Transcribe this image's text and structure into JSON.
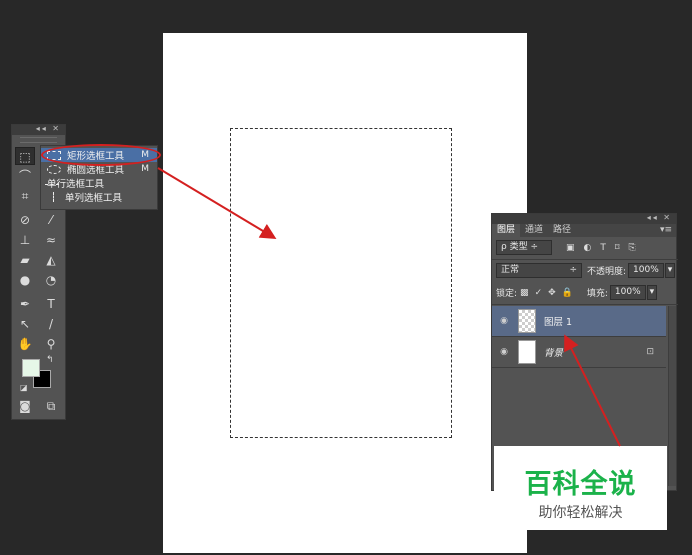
{
  "toolbar": {
    "collapse_label": "◂◂ ✕",
    "tools": [
      {
        "name": "marquee",
        "glyph": "⬚"
      },
      {
        "name": "lasso",
        "glyph": "⌒"
      },
      {
        "name": "crop",
        "glyph": "⌗"
      },
      {
        "name": "eyedropper",
        "glyph": "⊘"
      },
      {
        "name": "spot-healing",
        "glyph": "✎"
      },
      {
        "name": "brush",
        "glyph": "⁄"
      },
      {
        "name": "clone-stamp",
        "glyph": "⊥"
      },
      {
        "name": "history-brush",
        "glyph": "≈"
      },
      {
        "name": "eraser",
        "glyph": "▰"
      },
      {
        "name": "paint-bucket",
        "glyph": "◭"
      },
      {
        "name": "blur",
        "glyph": "●"
      },
      {
        "name": "dodge",
        "glyph": "◔"
      },
      {
        "name": "pen",
        "glyph": "✒"
      },
      {
        "name": "type",
        "glyph": "T"
      },
      {
        "name": "path-selection",
        "glyph": "↖"
      },
      {
        "name": "line",
        "glyph": "/"
      },
      {
        "name": "hand",
        "glyph": "✋"
      },
      {
        "name": "zoom",
        "glyph": "⚲"
      }
    ],
    "foreground_color": "#e6f7e8",
    "background_color": "#000000",
    "quick_mask_glyph": "◙",
    "screen_mode_glyph": "⧉"
  },
  "flyout": {
    "items": [
      {
        "label": "矩形选框工具",
        "key": "M"
      },
      {
        "label": "椭圆选框工具",
        "key": "M"
      },
      {
        "label": "单行选框工具",
        "key": ""
      },
      {
        "label": "单列选框工具",
        "key": ""
      }
    ]
  },
  "layers_panel": {
    "collapse_label": "◂◂ ✕",
    "tabs": [
      "图层",
      "通道",
      "路径"
    ],
    "menu_glyph": "▾≡",
    "filter_label": "ρ 类型",
    "filter_icons": [
      "▣",
      "◐",
      "T",
      "⌑",
      "⎘"
    ],
    "blend_mode": "正常",
    "opacity_label": "不透明度:",
    "opacity_value": "100%",
    "lock_label": "锁定:",
    "lock_icons": [
      "▩",
      "✓",
      "✥",
      "🔒"
    ],
    "fill_label": "填充:",
    "fill_value": "100%",
    "layers": [
      {
        "name": "图层 1",
        "selected": true
      },
      {
        "name": "背景",
        "selected": false
      }
    ]
  },
  "watermark": {
    "title": "百科全说",
    "subtitle": "助你轻松解决"
  },
  "colors": {
    "annotation_red": "#d42020",
    "watermark_green": "#1bb24a"
  }
}
